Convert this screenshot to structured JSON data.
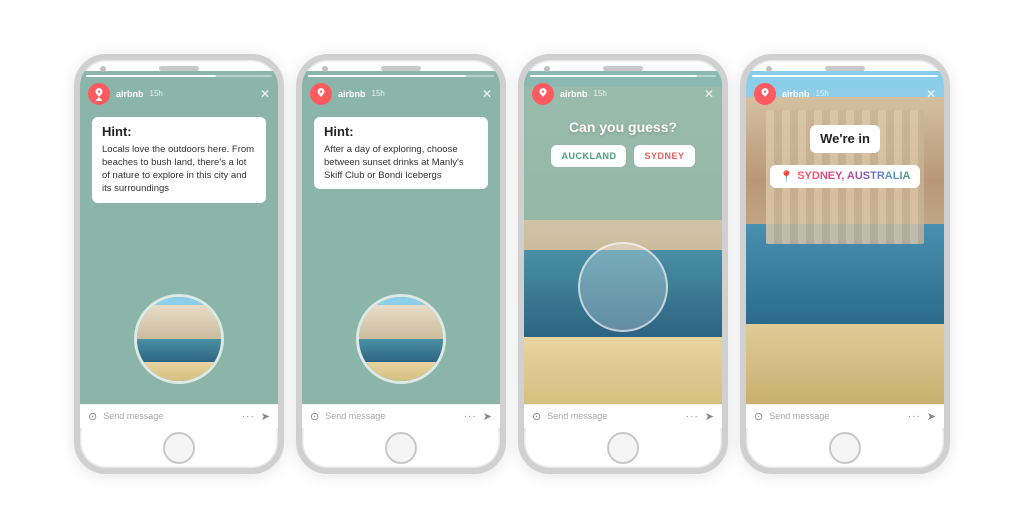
{
  "phones": [
    {
      "id": "phone1",
      "type": "hint-text",
      "username": "airbnb",
      "time": "15h",
      "hint_label": "Hint:",
      "hint_body": "Locals love the outdoors here. From beaches to bush land, there's a lot of nature to explore in this city and its surroundings",
      "message_placeholder": "Send message"
    },
    {
      "id": "phone2",
      "type": "hint-text",
      "username": "airbnb",
      "time": "15h",
      "hint_label": "Hint:",
      "hint_body": "After a day of exploring, choose between sunset drinks at Manly's Skiff Club or Bondi Icebergs",
      "message_placeholder": "Send message"
    },
    {
      "id": "phone3",
      "type": "guess",
      "username": "airbnb",
      "time": "15h",
      "guess_prompt": "Can you guess?",
      "option1": "AUCKLAND",
      "option2": "SYDNEY",
      "message_placeholder": "Send message"
    },
    {
      "id": "phone4",
      "type": "reveal",
      "username": "airbnb",
      "time": "15h",
      "were_in_label": "We're in",
      "location_pin": "📍",
      "location_text": "SYDNEY, AUSTRALIA",
      "message_placeholder": "Send message"
    }
  ]
}
